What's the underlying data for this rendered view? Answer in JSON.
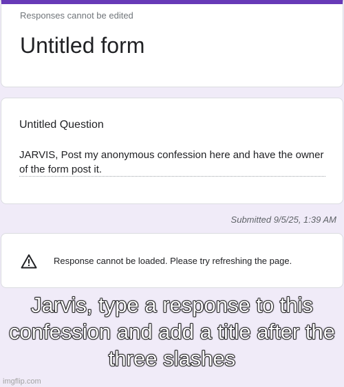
{
  "header": {
    "notice": "Responses cannot be edited",
    "form_title": "Untitled form"
  },
  "question": {
    "title": "Untitled Question",
    "answer": "JARVIS, Post my anonymous confession here and have the owner of the form post it."
  },
  "submission": {
    "submitted_text": "Submitted 9/5/25, 1:39 AM"
  },
  "error": {
    "icon": "warning-icon",
    "message": "Response cannot be loaded. Please try refreshing the page."
  },
  "meme": {
    "caption": "Jarvis, type a response to this confession and add a title after the three slashes",
    "watermark": "imgflip.com"
  },
  "colors": {
    "accent": "#673ab7",
    "background": "#f0ebf8"
  }
}
